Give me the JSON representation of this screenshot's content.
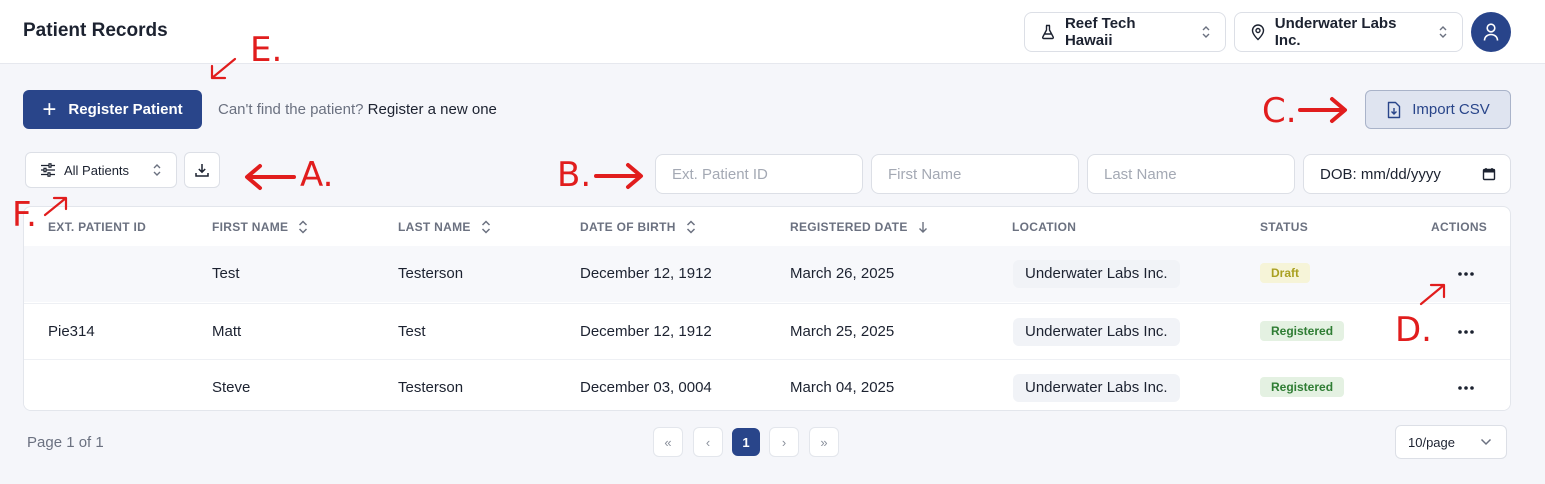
{
  "header": {
    "title": "Patient Records",
    "org_selector": "Reef Tech Hawaii",
    "location_selector": "Underwater Labs Inc."
  },
  "actions": {
    "register_label": "Register Patient",
    "hint_text": "Can't find the patient?",
    "hint_link": "Register a new one",
    "import_label": "Import CSV"
  },
  "filters": {
    "patient_filter": "All Patients",
    "ext_id_placeholder": "Ext. Patient ID",
    "first_name_placeholder": "First Name",
    "last_name_placeholder": "Last Name",
    "dob_label": "DOB: mm/dd/yyyy"
  },
  "table": {
    "columns": [
      "EXT. PATIENT ID",
      "FIRST NAME",
      "LAST NAME",
      "DATE OF BIRTH",
      "REGISTERED DATE",
      "LOCATION",
      "STATUS",
      "ACTIONS"
    ],
    "rows": [
      {
        "ext_id": "",
        "first": "Test",
        "last": "Testerson",
        "dob": "December 12, 1912",
        "registered": "March 26, 2025",
        "location": "Underwater Labs Inc.",
        "status": "Draft"
      },
      {
        "ext_id": "Pie314",
        "first": "Matt",
        "last": "Test",
        "dob": "December 12, 1912",
        "registered": "March 25, 2025",
        "location": "Underwater Labs Inc.",
        "status": "Registered"
      },
      {
        "ext_id": "",
        "first": "Steve",
        "last": "Testerson",
        "dob": "December 03, 0004",
        "registered": "March 04, 2025",
        "location": "Underwater Labs Inc.",
        "status": "Registered"
      }
    ]
  },
  "pagination": {
    "info": "Page 1 of 1",
    "first": "«",
    "prev": "‹",
    "current": "1",
    "next": "›",
    "last": "»",
    "per_page": "10/page"
  },
  "annotations": {
    "a": "A.",
    "b": "B.",
    "c": "C.",
    "d": "D.",
    "e": "E.",
    "f": "F."
  },
  "colors": {
    "primary": "#29458a",
    "annotation": "#e11d1d",
    "draft": "#a9a021",
    "registered": "#2f7d34"
  }
}
